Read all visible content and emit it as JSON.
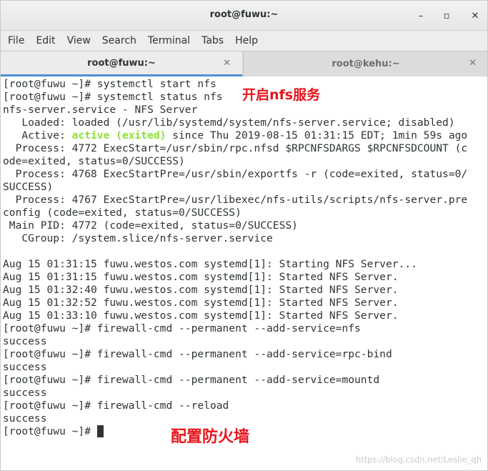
{
  "window": {
    "title": "root@fuwu:~"
  },
  "window_controls": {
    "minimize": "–",
    "maximize": "▫",
    "close": "✕"
  },
  "menu": [
    "File",
    "Edit",
    "View",
    "Search",
    "Terminal",
    "Tabs",
    "Help"
  ],
  "tabs": [
    {
      "label": "root@fuwu:~",
      "active": true,
      "close": "✕"
    },
    {
      "label": "root@kehu:~",
      "active": false,
      "close": "✕"
    }
  ],
  "terminal": {
    "lines": [
      "[root@fuwu ~]# systemctl start nfs",
      "[root@fuwu ~]# systemctl status nfs",
      "nfs-server.service - NFS Server",
      "   Loaded: loaded (/usr/lib/systemd/system/nfs-server.service; disabled)",
      "   Active: ",
      "  Process: 4772 ExecStart=/usr/sbin/rpc.nfsd $RPCNFSDARGS $RPCNFSDCOUNT (c",
      "ode=exited, status=0/SUCCESS)",
      "  Process: 4768 ExecStartPre=/usr/sbin/exportfs -r (code=exited, status=0/",
      "SUCCESS)",
      "  Process: 4767 ExecStartPre=/usr/libexec/nfs-utils/scripts/nfs-server.pre",
      "config (code=exited, status=0/SUCCESS)",
      " Main PID: 4772 (code=exited, status=0/SUCCESS)",
      "   CGroup: /system.slice/nfs-server.service",
      "",
      "Aug 15 01:31:15 fuwu.westos.com systemd[1]: Starting NFS Server...",
      "Aug 15 01:31:15 fuwu.westos.com systemd[1]: Started NFS Server.",
      "Aug 15 01:32:40 fuwu.westos.com systemd[1]: Started NFS Server.",
      "Aug 15 01:32:52 fuwu.westos.com systemd[1]: Started NFS Server.",
      "Aug 15 01:33:10 fuwu.westos.com systemd[1]: Started NFS Server.",
      "[root@fuwu ~]# firewall-cmd --permanent --add-service=nfs",
      "success",
      "[root@fuwu ~]# firewall-cmd --permanent --add-service=rpc-bind",
      "success",
      "[root@fuwu ~]# firewall-cmd --permanent --add-service=mountd",
      "success",
      "[root@fuwu ~]# firewall-cmd --reload",
      "success"
    ],
    "active_status": "active (exited)",
    "active_rest": " since Thu 2019-08-15 01:31:15 EDT; 1min 59s ago",
    "prompt": "[root@fuwu ~]# "
  },
  "annotations": {
    "start_nfs": "开启nfs服务",
    "firewall": "配置防火墙"
  },
  "watermark": "https://blog.csdn.net/Leslie_qh",
  "colors": {
    "annotation": "#e8141c",
    "active_status": "#8ae234",
    "tab_underline": "#4a90d9"
  }
}
